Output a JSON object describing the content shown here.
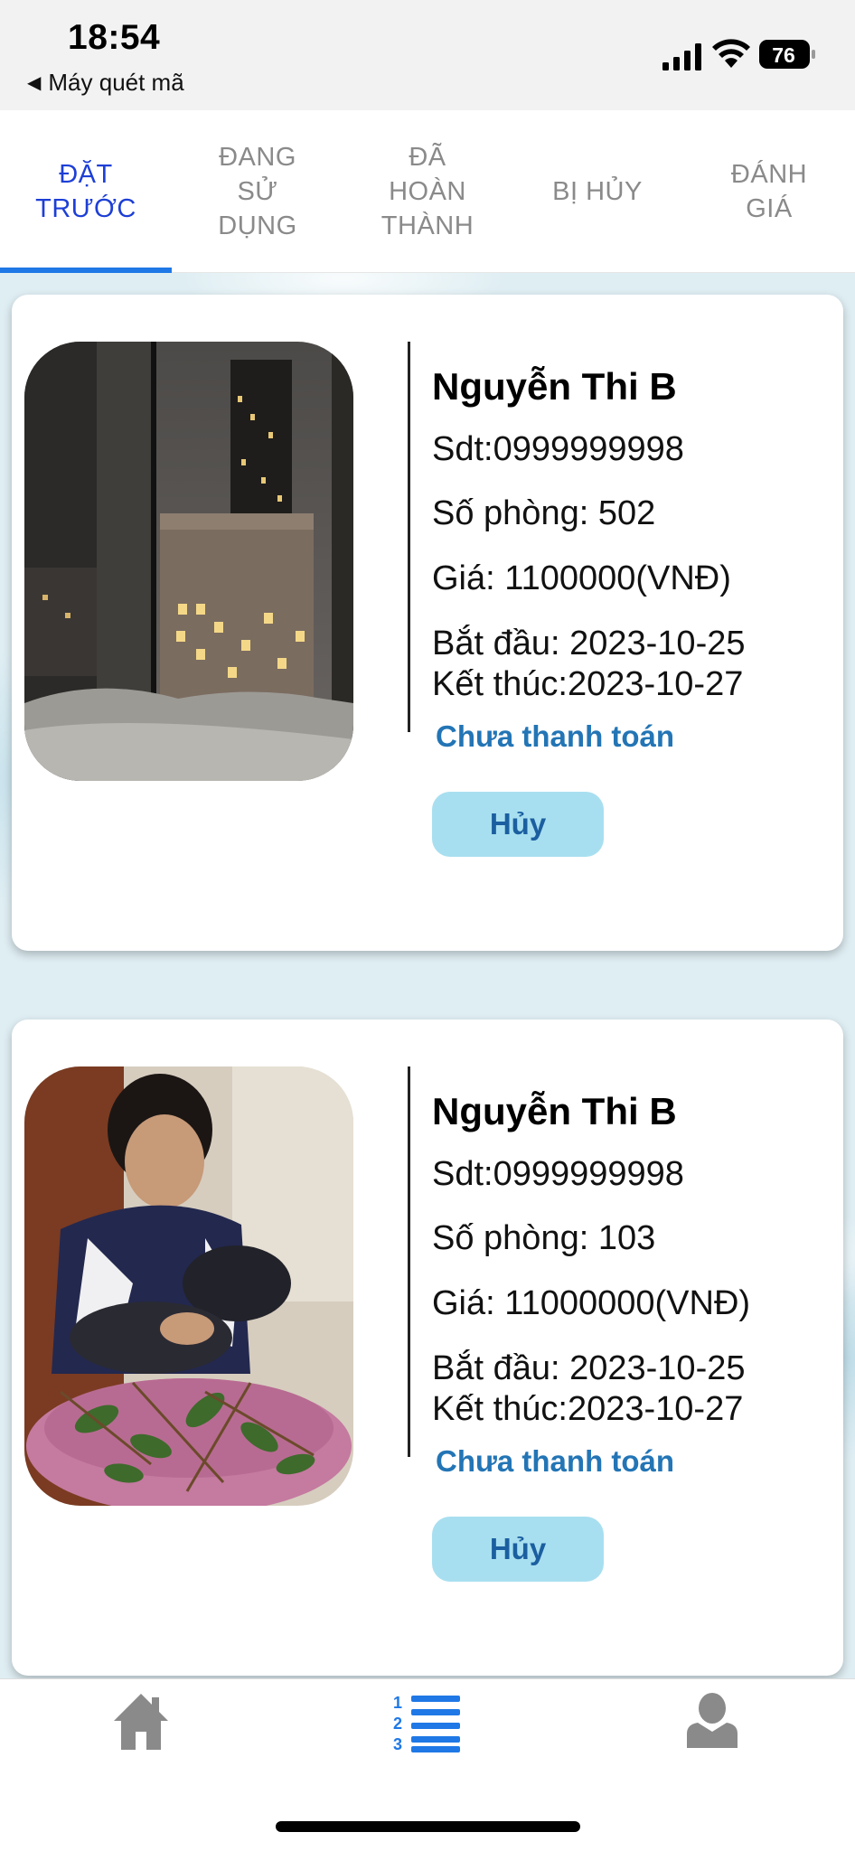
{
  "status_bar": {
    "time": "18:54",
    "back_app": "Máy quét mã",
    "battery": "76"
  },
  "tabs": [
    {
      "label": "ĐẶT\nTRƯỚC",
      "active": true
    },
    {
      "label": "ĐANG\nSỬ\nDỤNG",
      "active": false
    },
    {
      "label": "ĐÃ\nHOÀN\nTHÀNH",
      "active": false
    },
    {
      "label": "BỊ HỦY",
      "active": false
    },
    {
      "label": "ĐÁNH\nGIÁ",
      "active": false
    }
  ],
  "bookings": [
    {
      "name": "Nguyễn Thi B",
      "phone": "Sdt:0999999998",
      "room": "Số phòng: 502",
      "price": "Giá: 1100000(VNĐ)",
      "start": "Bắt đầu: 2023-10-25",
      "end": "Kết thúc:2023-10-27",
      "payment_status": "Chưa thanh toán",
      "cancel_label": "Hủy",
      "photo": "city-night-window"
    },
    {
      "name": "Nguyễn Thi B",
      "phone": "Sdt:0999999998",
      "room": "Số phòng: 103",
      "price": "Giá: 11000000(VNĐ)",
      "start": "Bắt đầu: 2023-10-25",
      "end": "Kết thúc:2023-10-27",
      "payment_status": "Chưa thanh toán",
      "cancel_label": "Hủy",
      "photo": "person-sitting"
    }
  ],
  "bottom_nav": {
    "items": [
      {
        "icon": "home-icon",
        "active": false
      },
      {
        "icon": "numbered-list-icon",
        "active": true
      },
      {
        "icon": "user-icon",
        "active": false
      }
    ]
  },
  "colors": {
    "active_tab": "#1d3fd6",
    "tab_indicator": "#1f78e6",
    "payment_status": "#2375b5",
    "cancel_button_bg": "#a8dff0",
    "cancel_button_text": "#1b5fa0",
    "nav_active": "#1f78e6",
    "nav_inactive": "#8a8a8a"
  }
}
